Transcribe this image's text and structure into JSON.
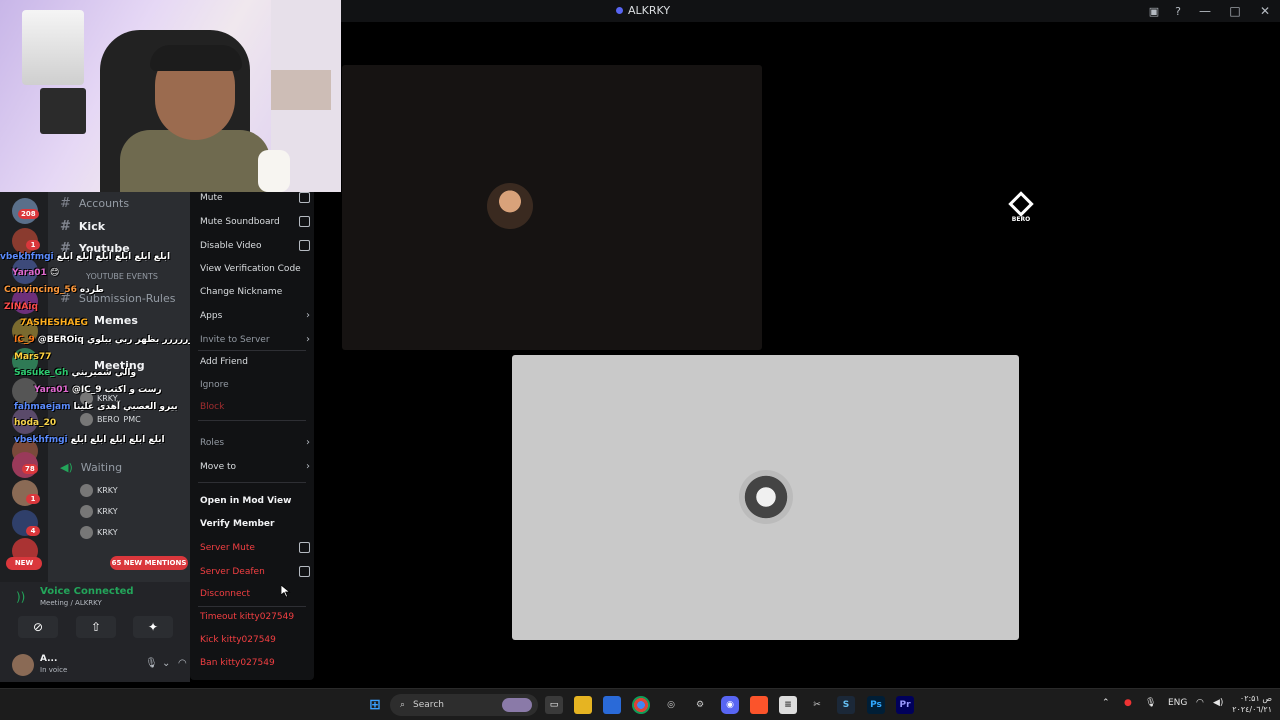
{
  "window": {
    "title": "ALKRKY"
  },
  "servers": [
    {
      "badge": "208"
    },
    {
      "badge": "1"
    },
    {
      "badge": ""
    },
    {
      "badge": ""
    },
    {
      "badge": ""
    },
    {
      "badge": ""
    },
    {
      "badge": ""
    },
    {
      "badge": ""
    },
    {
      "badge": ""
    },
    {
      "badge": "78"
    },
    {
      "badge": "1"
    },
    {
      "badge": "4"
    }
  ],
  "channels": {
    "accounts": "Accounts",
    "kick": "Kick",
    "youtube": "Youtube",
    "youtube_events": "YOUTUBE EVENTS",
    "submission_rules": "Submission-Rules",
    "memes": "Memes",
    "meeting": "Meeting",
    "waiting": "Waiting"
  },
  "voice_users": {
    "meeting": [
      "KRKY",
      "BERO",
      "PMC"
    ],
    "waiting": [
      "KRKY",
      "KRKY",
      "KRKY"
    ]
  },
  "chat": [
    {
      "user": "vbekhfmgi",
      "msg": "ابلع ابلع ابلع ابلع ابلع ابلع",
      "color": "#5b8cff"
    },
    {
      "user": "Yara01",
      "msg": "😊",
      "color": "#e06ad0"
    },
    {
      "user": "Convincing_56",
      "msg": "طرده",
      "color": "#ff9a3c"
    },
    {
      "user": "ZINAiq",
      "msg": "",
      "color": "#ff4d4d"
    },
    {
      "user": "7ASHESHAEG",
      "msg": "",
      "color": "#ffb020"
    },
    {
      "user": "IC_9",
      "msg": "@BEROiq خلاص جرررررررررررررررررررررر بظهر ربي ببلوي",
      "color": "#ff7a1a"
    },
    {
      "user": "Mars77",
      "msg": "",
      "color": "#ffd23f"
    },
    {
      "user": "Sasuke_Gh",
      "msg": "والي شمبريني",
      "color": "#2ecc71"
    },
    {
      "user": "Yara01",
      "msg": "@IC_9 رست و اكتب",
      "color": "#e06ad0"
    },
    {
      "user": "fahmaejam",
      "msg": "بيرو العصبي آهدى علينا",
      "color": "#5b8cff"
    },
    {
      "user": "hoda_20",
      "msg": "",
      "color": "#f7d44c"
    },
    {
      "user": "vbekhfmgi",
      "msg": "ابلع ابلع ابلع ابلع ابلع",
      "color": "#5b8cff"
    }
  ],
  "pills": {
    "new": "NEW",
    "mentions": "65 NEW MENTIONS"
  },
  "voice": {
    "status": "Voice Connected",
    "location": "Meeting / ALKRKY",
    "user_name": "A...",
    "user_sub": "In voice"
  },
  "context_menu": {
    "mute": "Mute",
    "mute_soundboard": "Mute Soundboard",
    "disable_video": "Disable Video",
    "view_verification_code": "View Verification Code",
    "change_nickname": "Change Nickname",
    "apps": "Apps",
    "invite_to_server": "Invite to Server",
    "add_friend": "Add Friend",
    "ignore": "Ignore",
    "block": "Block",
    "roles": "Roles",
    "move_to": "Move to",
    "open_in_mod_view": "Open in Mod View",
    "verify_member": "Verify Member",
    "server_mute": "Server Mute",
    "server_deafen": "Server Deafen",
    "disconnect": "Disconnect",
    "timeout": "Timeout kitty027549",
    "kick": "Kick kitty027549",
    "ban": "Ban kitty027549"
  },
  "stage": {
    "bero_label": "BERO"
  },
  "taskbar": {
    "search": "Search",
    "lang": "ENG",
    "time": "۰۲:۵۱ ص",
    "date": "۲۰۲٤/۰٦/۲۱"
  },
  "colors": {
    "accent": "#5865f2",
    "danger": "#f23f42",
    "online": "#23a55a",
    "badge": "#da373c"
  }
}
